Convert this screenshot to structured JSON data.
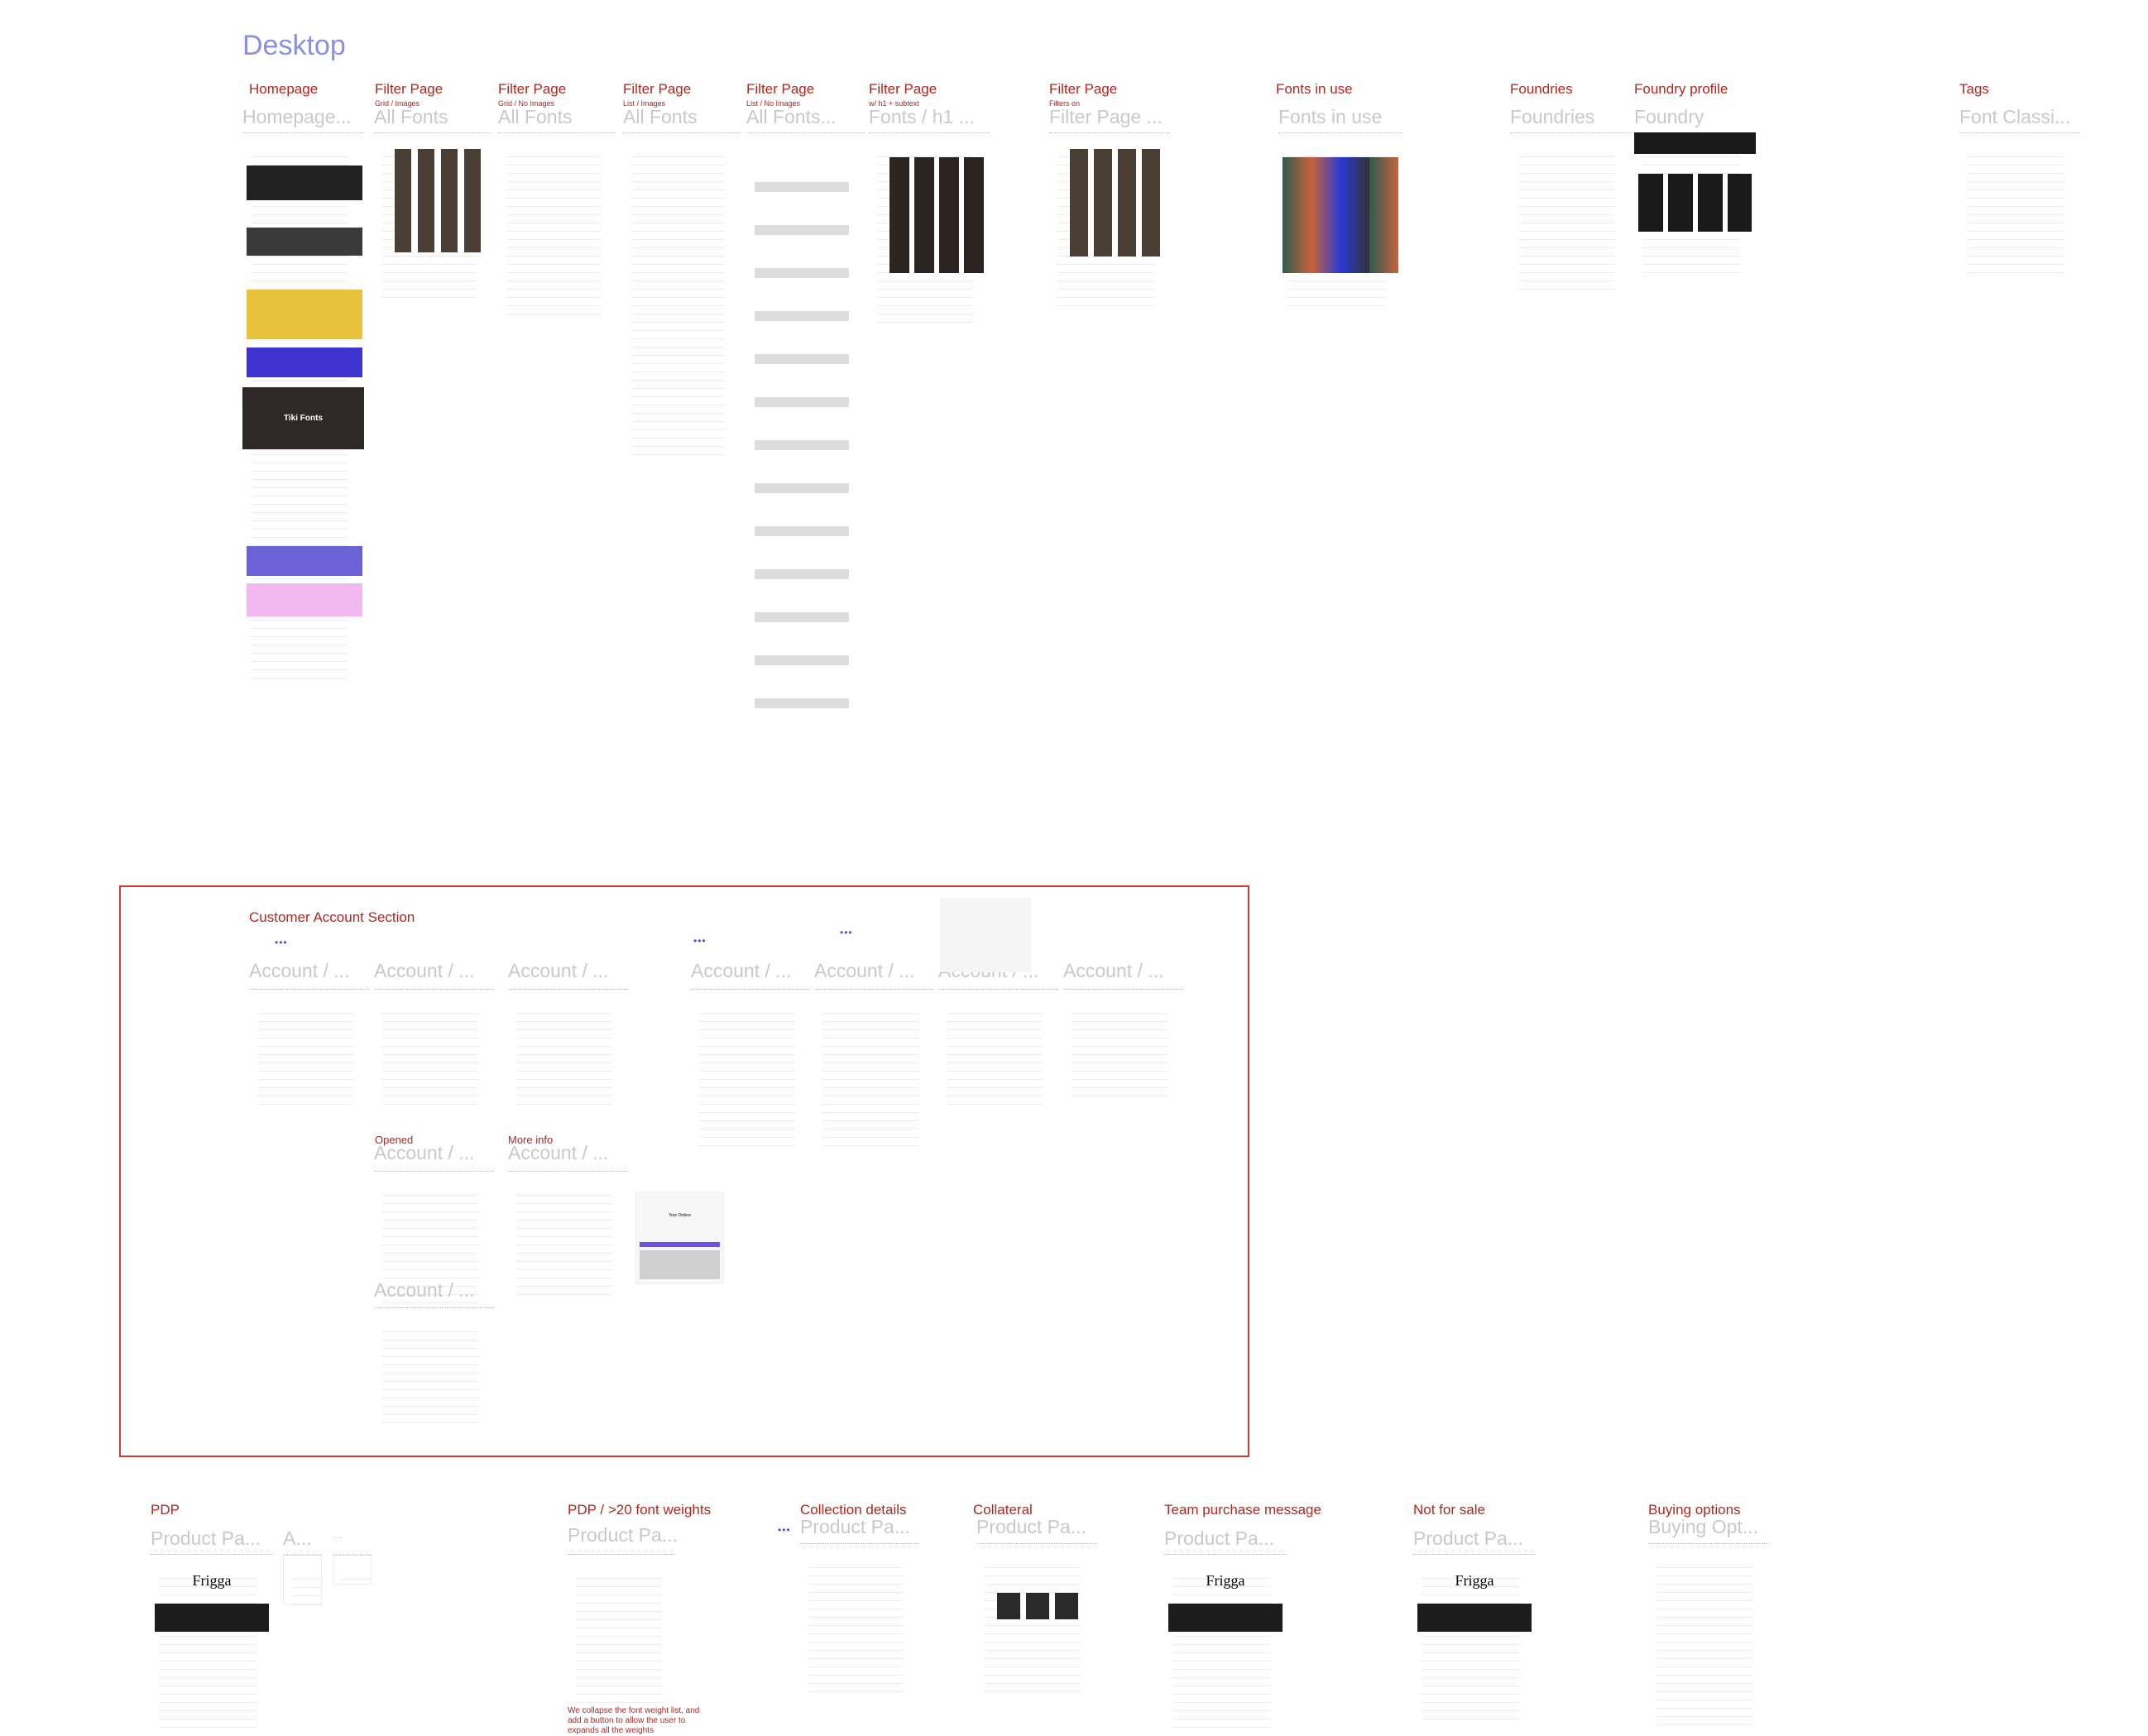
{
  "page_title": "Desktop",
  "desktop_frames": [
    {
      "section": "Homepage",
      "sublabel": "",
      "title": "Homepage..."
    },
    {
      "section": "Filter Page",
      "sublabel": "Grid / Images",
      "title": "All Fonts"
    },
    {
      "section": "Filter Page",
      "sublabel": "Grid / No Images",
      "title": "All Fonts"
    },
    {
      "section": "Filter Page",
      "sublabel": "List / Images",
      "title": "All Fonts"
    },
    {
      "section": "Filter Page",
      "sublabel": "List / No Images",
      "title": "All Fonts..."
    },
    {
      "section": "Filter Page",
      "sublabel": "w/ h1 + subtext",
      "title": "Fonts / h1 ..."
    },
    {
      "section": "Filter Page",
      "sublabel": "Filters on",
      "title": "Filter Page ..."
    },
    {
      "section": "Fonts in use",
      "sublabel": "",
      "title": "Fonts in use"
    },
    {
      "section": "Foundries",
      "sublabel": "",
      "title": "Foundries"
    },
    {
      "section": "Foundry profile",
      "sublabel": "",
      "title": "Foundry"
    },
    {
      "section": "Tags",
      "sublabel": "",
      "title": "Font Classi..."
    }
  ],
  "account_section": {
    "label": "Customer Account Section",
    "frames": [
      "Account / ...",
      "Account / ...",
      "Account / ...",
      "Account / ...",
      "Account / ...",
      "Account / ...",
      "Account / ..."
    ],
    "opened": {
      "label": "Opened",
      "title": "Account / ..."
    },
    "more_info": {
      "label": "More info",
      "title": "Account / ..."
    },
    "extra": {
      "title": "Account / ..."
    },
    "orders_title": "Your Orders"
  },
  "pdp_frames": [
    {
      "section": "PDP",
      "title": "Product Pa...",
      "extra_titles": [
        "A...",
        "..."
      ]
    },
    {
      "section": "PDP / >20 font weights",
      "title": "Product Pa..."
    },
    {
      "section": "Collection details",
      "title": "Product Pa..."
    },
    {
      "section": "Collateral",
      "title": "Product Pa..."
    },
    {
      "section": "Team purchase message",
      "title": "Product Pa..."
    },
    {
      "section": "Not for sale",
      "title": "Product Pa..."
    },
    {
      "section": "Buying options",
      "title": "Buying Opt..."
    }
  ],
  "pdp_note": "We collapse the font weight list, and add a button to allow the user to expands all the weights",
  "thumb_text": {
    "frigga": "Frigga",
    "tiki": "Tiki Fonts"
  },
  "colors": {
    "section_label": "#b3261e",
    "frame_title": "#c9c9c9",
    "page_title": "#8a8fe0",
    "highlight_box": "#d43a3a",
    "accent": "#5b45d6"
  }
}
